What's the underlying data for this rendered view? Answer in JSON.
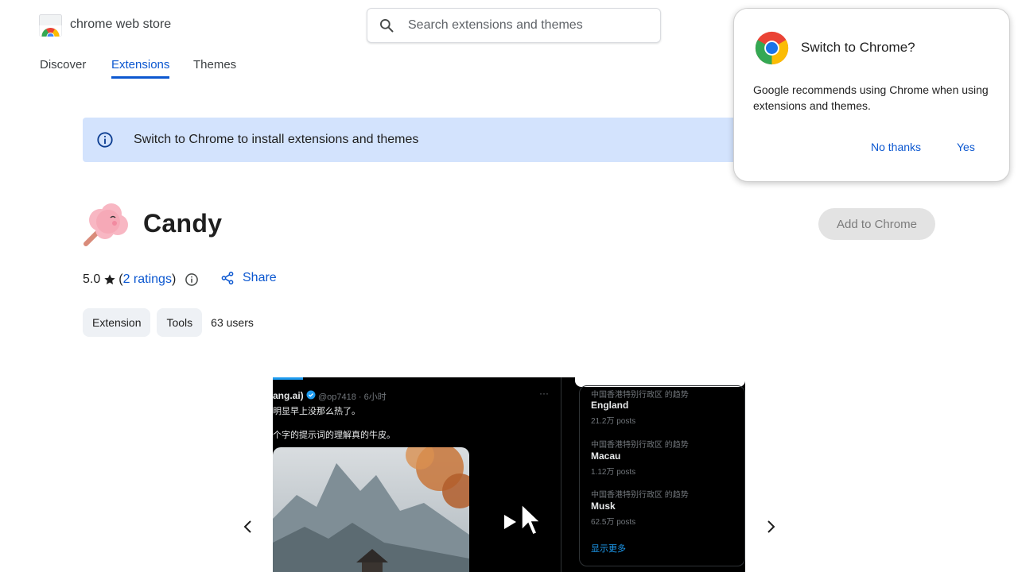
{
  "header": {
    "brand": "chrome web store",
    "search_placeholder": "Search extensions and themes"
  },
  "nav": {
    "tabs": [
      {
        "label": "Discover"
      },
      {
        "label": "Extensions"
      },
      {
        "label": "Themes"
      }
    ],
    "active_tab": "Extensions"
  },
  "banner": {
    "text": "Switch to Chrome to install extensions and themes"
  },
  "popup": {
    "title": "Switch to Chrome?",
    "body": "Google recommends using Chrome when using extensions and themes.",
    "no_label": "No thanks",
    "yes_label": "Yes"
  },
  "extension": {
    "name": "Candy",
    "add_label": "Add to Chrome",
    "rating": "5.0",
    "ratings_link": "2 ratings",
    "share_label": "Share",
    "chips": [
      "Extension",
      "Tools"
    ],
    "users": "63 users"
  },
  "screenshot": {
    "post_handle": "ang.ai)",
    "post_user": "@op7418 · 6小时",
    "post_line1": "明显早上没那么热了。",
    "post_line2": "个字的提示词的理解真的牛皮。",
    "trends": [
      {
        "context": "中国香港特别行政区 的趋势",
        "name": "England",
        "posts": "21.2万 posts"
      },
      {
        "context": "中国香港特别行政区 的趋势",
        "name": "Macau",
        "posts": "1.12万 posts"
      },
      {
        "context": "中国香港特别行政区 的趋势",
        "name": "Musk",
        "posts": "62.5万 posts"
      }
    ],
    "show_more": "显示更多"
  },
  "colors": {
    "accent": "#0b57d0",
    "banner_bg": "#d3e3fd",
    "chip_bg": "#eef1f5",
    "disabled_btn": "#e3e3e3"
  }
}
